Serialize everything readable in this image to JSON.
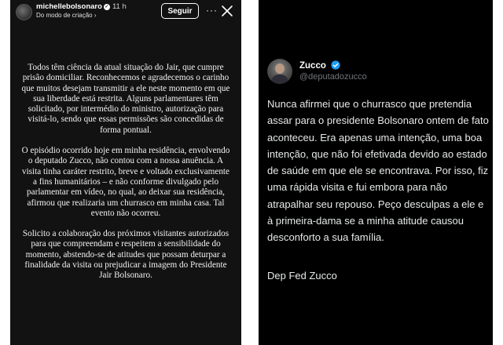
{
  "story": {
    "username": "michellebolsonaro",
    "time": "11 h",
    "sublabel": "Do modo de criação ›",
    "follow_label": "Seguir",
    "more_glyph": "···",
    "paragraphs": [
      "Todos têm ciência da atual situação do Jair, que cumpre prisão domiciliar. Reconhecemos e agradecemos o carinho que muitos desejam transmitir a ele neste momento em que sua liberdade está restrita. Alguns parlamentares têm solicitado, por intermédio do ministro, autorização para visitá-lo, sendo que essas permissões são concedidas de forma pontual.",
      "O episódio ocorrido hoje em minha residência, envolvendo o deputado Zucco, não contou com a nossa anuência. A visita tinha caráter restrito, breve e voltado exclusivamente a fins humanitários – e não conforme divulgado pelo parlamentar em vídeo, no qual, ao deixar sua residência, afirmou que realizaria um churrasco em minha casa. Tal evento não ocorreu.",
      "Solicito a colaboração dos próximos visitantes autorizados para que compreendam e respeitem a sensibilidade do momento, abstendo-se de atitudes que possam deturpar a finalidade da visita ou prejudicar a imagem do Presidente Jair Bolsonaro."
    ]
  },
  "tweet": {
    "display_name": "Zucco",
    "handle": "@deputadozucco",
    "body": "Nunca afirmei que o churrasco que pretendia assar para o presidente Bolsonaro ontem de fato aconteceu. Era apenas uma intenção, uma boa intenção, que não foi efetivada devido ao estado de saúde em que ele se encontrava. Por isso, fiz uma rápida visita e fui embora para não atrapalhar seu repouso. Peço desculpas a ele e à primeira-dama se a minha atitude causou desconforto a sua família.",
    "signature": "Dep Fed Zucco",
    "verified_color": "#1d9bf0"
  },
  "colors": {
    "story_bg": "#121212",
    "tweet_bg": "#000000",
    "handle_gray": "#71767b"
  },
  "icons": {
    "story_avatar": "avatar",
    "story_verified": "verified-icon",
    "more": "more-options-icon",
    "close": "close-icon",
    "tweet_verified": "verified-badge-icon"
  }
}
